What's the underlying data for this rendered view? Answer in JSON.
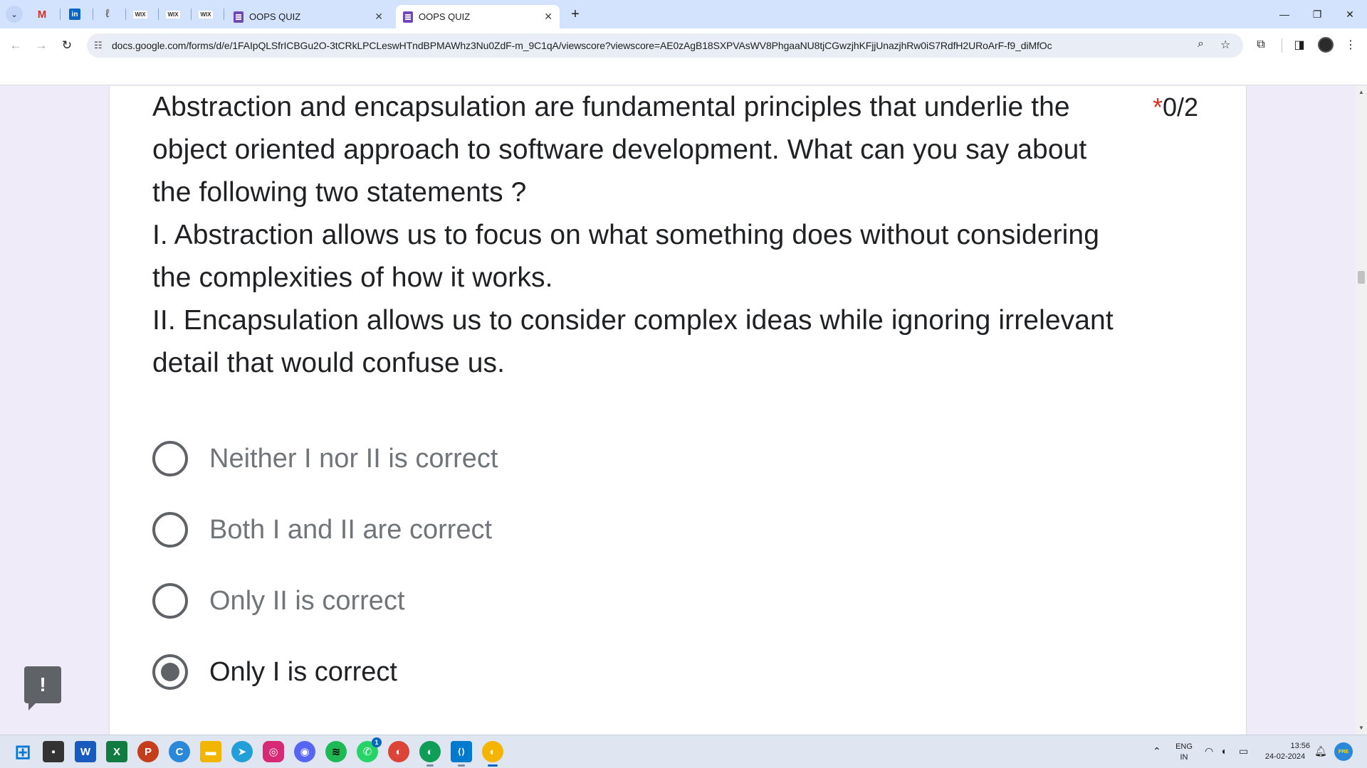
{
  "browser": {
    "tab_list_glyph": "⌄",
    "pinned_tabs": [
      {
        "icon": "gmail-icon",
        "glyph": "M"
      },
      {
        "icon": "linkedin-icon",
        "glyph": "in"
      },
      {
        "icon": "app-icon",
        "glyph": "ℓ"
      },
      {
        "icon": "wix-icon",
        "glyph": "WIX"
      },
      {
        "icon": "wix-icon",
        "glyph": "WIX"
      },
      {
        "icon": "wix-icon",
        "glyph": "WIX"
      }
    ],
    "tabs": [
      {
        "title": "OOPS QUIZ",
        "active": false
      },
      {
        "title": "OOPS QUIZ",
        "active": true
      }
    ],
    "url": "docs.google.com/forms/d/e/1FAIpQLSfrICBGu2O-3tCRkLPCLeswHTndBPMAWhz3Nu0ZdF-m_9C1qA/viewscore?viewscore=AE0zAgB18SXPVAsWV8PhgaaNU8tjCGwzjhKFjjUnazjhRw0iS7RdfH2URoArF-f9_diMfOc"
  },
  "question": {
    "lines": [
      "Abstraction and encapsulation are fundamental principles that underlie the",
      "object oriented approach to software development. What can you say about",
      "the following two statements ?",
      "I. Abstraction allows us to focus on what something does without considering",
      "the complexities of how it works.",
      "II. Encapsulation allows us to consider complex ideas while ignoring irrelevant",
      "detail that would confuse us."
    ],
    "required_marker": "*",
    "score": "0/2"
  },
  "options": [
    {
      "label": "Neither I nor II is correct",
      "checked": false
    },
    {
      "label": "Both I and II are correct",
      "checked": false
    },
    {
      "label": "Only II is correct",
      "checked": false
    },
    {
      "label": "Only I is correct",
      "checked": true
    }
  ],
  "feedback_button_glyph": "!",
  "taskbar": {
    "apps": [
      {
        "name": "windows-start-icon",
        "glyph": "⊞",
        "color": "#0078d4"
      },
      {
        "name": "file-manager-icon",
        "glyph": "▪",
        "color": "#333333"
      },
      {
        "name": "word-icon",
        "glyph": "W",
        "color": "#185abd"
      },
      {
        "name": "excel-icon",
        "glyph": "X",
        "color": "#107c41"
      },
      {
        "name": "powerpoint-icon",
        "glyph": "P",
        "color": "#c43e1c"
      },
      {
        "name": "c-app-icon",
        "glyph": "C",
        "color": "#2b88d8"
      },
      {
        "name": "folder-icon",
        "glyph": "▬",
        "color": "#f2b600"
      },
      {
        "name": "telegram-icon",
        "glyph": "➤",
        "color": "#229ed9"
      },
      {
        "name": "instagram-icon",
        "glyph": "◎",
        "color": "#d62976"
      },
      {
        "name": "discord-icon",
        "glyph": "◉",
        "color": "#5865f2"
      },
      {
        "name": "spotify-icon",
        "glyph": "≋",
        "color": "#1db954"
      },
      {
        "name": "whatsapp-icon",
        "glyph": "✆",
        "color": "#25d366"
      },
      {
        "name": "chrome-icon",
        "glyph": "◐",
        "color": "#db4437"
      },
      {
        "name": "chrome-profile-icon",
        "glyph": "◐",
        "color": "#0f9d58"
      },
      {
        "name": "vscode-icon",
        "glyph": "⟨⟩",
        "color": "#007acc"
      },
      {
        "name": "chrome-active-icon",
        "glyph": "◐",
        "color": "#f4b400"
      }
    ],
    "whatsapp_badge": "1",
    "language_line1": "ENG",
    "language_line2": "IN",
    "time": "13:56",
    "date": "24-02-2024",
    "pre_badge": "PRE"
  },
  "colors": {
    "page_background": "#f0ebf8",
    "required_star": "#d93025",
    "radio": "#5f6368"
  }
}
